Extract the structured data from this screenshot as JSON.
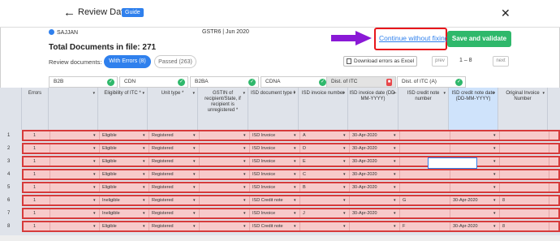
{
  "header": {
    "title": "Review Data",
    "guide_label": "Guide",
    "back_glyph": "←",
    "close_glyph": "✕"
  },
  "meta": {
    "user": "SAJJAN",
    "return_period": "GSTR6  |  Jun 2020"
  },
  "summary": {
    "total_text": "Total Documents in file: 271",
    "review_label": "Review documents:"
  },
  "filters": {
    "with_errors": "With Errors (8)",
    "passed": "Passed (263)"
  },
  "actions": {
    "continue_label": "Continue without fixing",
    "save_label": "Save and validate",
    "download_label": "Download errors as Excel"
  },
  "pagination": {
    "prev": "prev",
    "next": "next",
    "range": "1  –  8"
  },
  "colors": {
    "accent": "#2f80ed",
    "success": "#2fb86b",
    "error_row": "#f7caca",
    "error_border": "#d63b3b",
    "annotation_red": "#e8161b",
    "annotation_arrow": "#8a19d6"
  },
  "tabs": [
    {
      "label": "B2B",
      "status": "ok"
    },
    {
      "label": "CDN",
      "status": "ok"
    },
    {
      "label": "B2BA",
      "status": "ok"
    },
    {
      "label": "CDNA",
      "status": "ok"
    },
    {
      "label": "Dist. of ITC",
      "status": "error"
    },
    {
      "label": "Dist. of ITC (A)",
      "status": "ok"
    }
  ],
  "columns": [
    "Errors",
    "",
    "Eligibility of ITC *",
    "Unit type *",
    "GSTIN of recipient/State, if recipient is unregistered *",
    "ISD document type *",
    "ISD invoice number",
    "ISD invoice date (DD-MM-YYYY)",
    "ISD credit note number",
    "ISD credit note date (DD-MM-YYYY)",
    "Original Invoice Number"
  ],
  "rows": [
    {
      "n": "1",
      "errors": "1",
      "eligibility": "Eligible",
      "unit": "Registered",
      "doc_type": "ISD Invoice",
      "inv_no": "A",
      "inv_date": "30-Apr-2020",
      "cn_no": "",
      "cn_date": "",
      "orig": ""
    },
    {
      "n": "2",
      "errors": "1",
      "eligibility": "Eligible",
      "unit": "Registered",
      "doc_type": "ISD Invoice",
      "inv_no": "D",
      "inv_date": "30-Apr-2020",
      "cn_no": "",
      "cn_date": "",
      "orig": ""
    },
    {
      "n": "3",
      "errors": "1",
      "eligibility": "Eligible",
      "unit": "Registered",
      "doc_type": "ISD Invoice",
      "inv_no": "E",
      "inv_date": "30-Apr-2020",
      "cn_no": "",
      "cn_date": "",
      "orig": ""
    },
    {
      "n": "4",
      "errors": "1",
      "eligibility": "Eligible",
      "unit": "Registered",
      "doc_type": "ISD Invoice",
      "inv_no": "C",
      "inv_date": "30-Apr-2020",
      "cn_no": "",
      "cn_date": "",
      "orig": ""
    },
    {
      "n": "5",
      "errors": "1",
      "eligibility": "Eligible",
      "unit": "Registered",
      "doc_type": "ISD Invoice",
      "inv_no": "B",
      "inv_date": "30-Apr-2020",
      "cn_no": "",
      "cn_date": "",
      "orig": ""
    },
    {
      "n": "6",
      "errors": "1",
      "eligibility": "Ineligible",
      "unit": "Registered",
      "doc_type": "ISD Credit note",
      "inv_no": "",
      "inv_date": "",
      "cn_no": "G",
      "cn_date": "30-Apr-2020",
      "orig": "8"
    },
    {
      "n": "7",
      "errors": "1",
      "eligibility": "Ineligible",
      "unit": "Registered",
      "doc_type": "ISD Invoice",
      "inv_no": "J",
      "inv_date": "30-Apr-2020",
      "cn_no": "",
      "cn_date": "",
      "orig": ""
    },
    {
      "n": "8",
      "errors": "1",
      "eligibility": "Eligible",
      "unit": "Registered",
      "doc_type": "ISD Credit note",
      "inv_no": "",
      "inv_date": "",
      "cn_no": "F",
      "cn_date": "30-Apr-2020",
      "orig": "8"
    }
  ]
}
